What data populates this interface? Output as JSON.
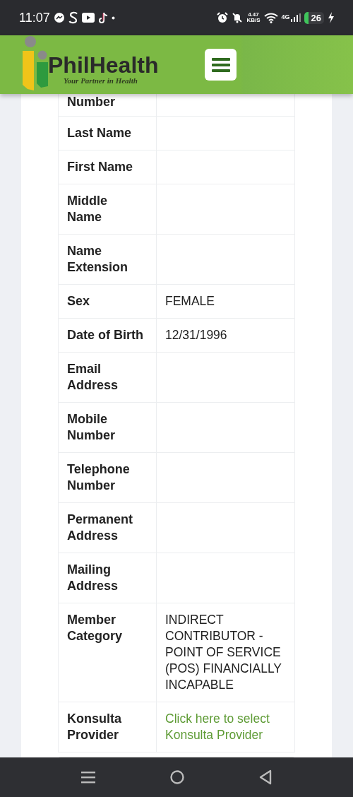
{
  "status_bar": {
    "time": "11:07",
    "net_speed": "4.47",
    "net_unit": "KB/S",
    "network": "4G",
    "battery": "26"
  },
  "header": {
    "brand": "PhilHealth",
    "tagline": "Your Partner in Health"
  },
  "rows": [
    {
      "label": "Number",
      "kind": "text"
    },
    {
      "label": "Last Name",
      "kind": "text"
    },
    {
      "label": "First Name",
      "kind": "text"
    },
    {
      "label": "Middle Name",
      "kind": "text"
    },
    {
      "label": "Name Extension",
      "kind": "text"
    },
    {
      "label": "Sex",
      "value": "FEMALE",
      "kind": "text"
    },
    {
      "label": "Date of Birth",
      "value": "12/31/1996",
      "kind": "text"
    },
    {
      "label": "Email Address",
      "kind": "text"
    },
    {
      "label": "Mobile Number",
      "kind": "text"
    },
    {
      "label": "Telephone Number",
      "kind": "text"
    },
    {
      "label": "Permanent Address",
      "kind": "text"
    },
    {
      "label": "Mailing Address",
      "kind": "text"
    },
    {
      "label": "Member Category",
      "value": "INDIRECT CONTRIBUTOR - POINT OF SERVICE (POS) FINANCIALLY INCAPABLE",
      "kind": "text"
    },
    {
      "label": "Konsulta Provider",
      "value": "Click here to select Konsulta Provider",
      "kind": "link"
    }
  ]
}
